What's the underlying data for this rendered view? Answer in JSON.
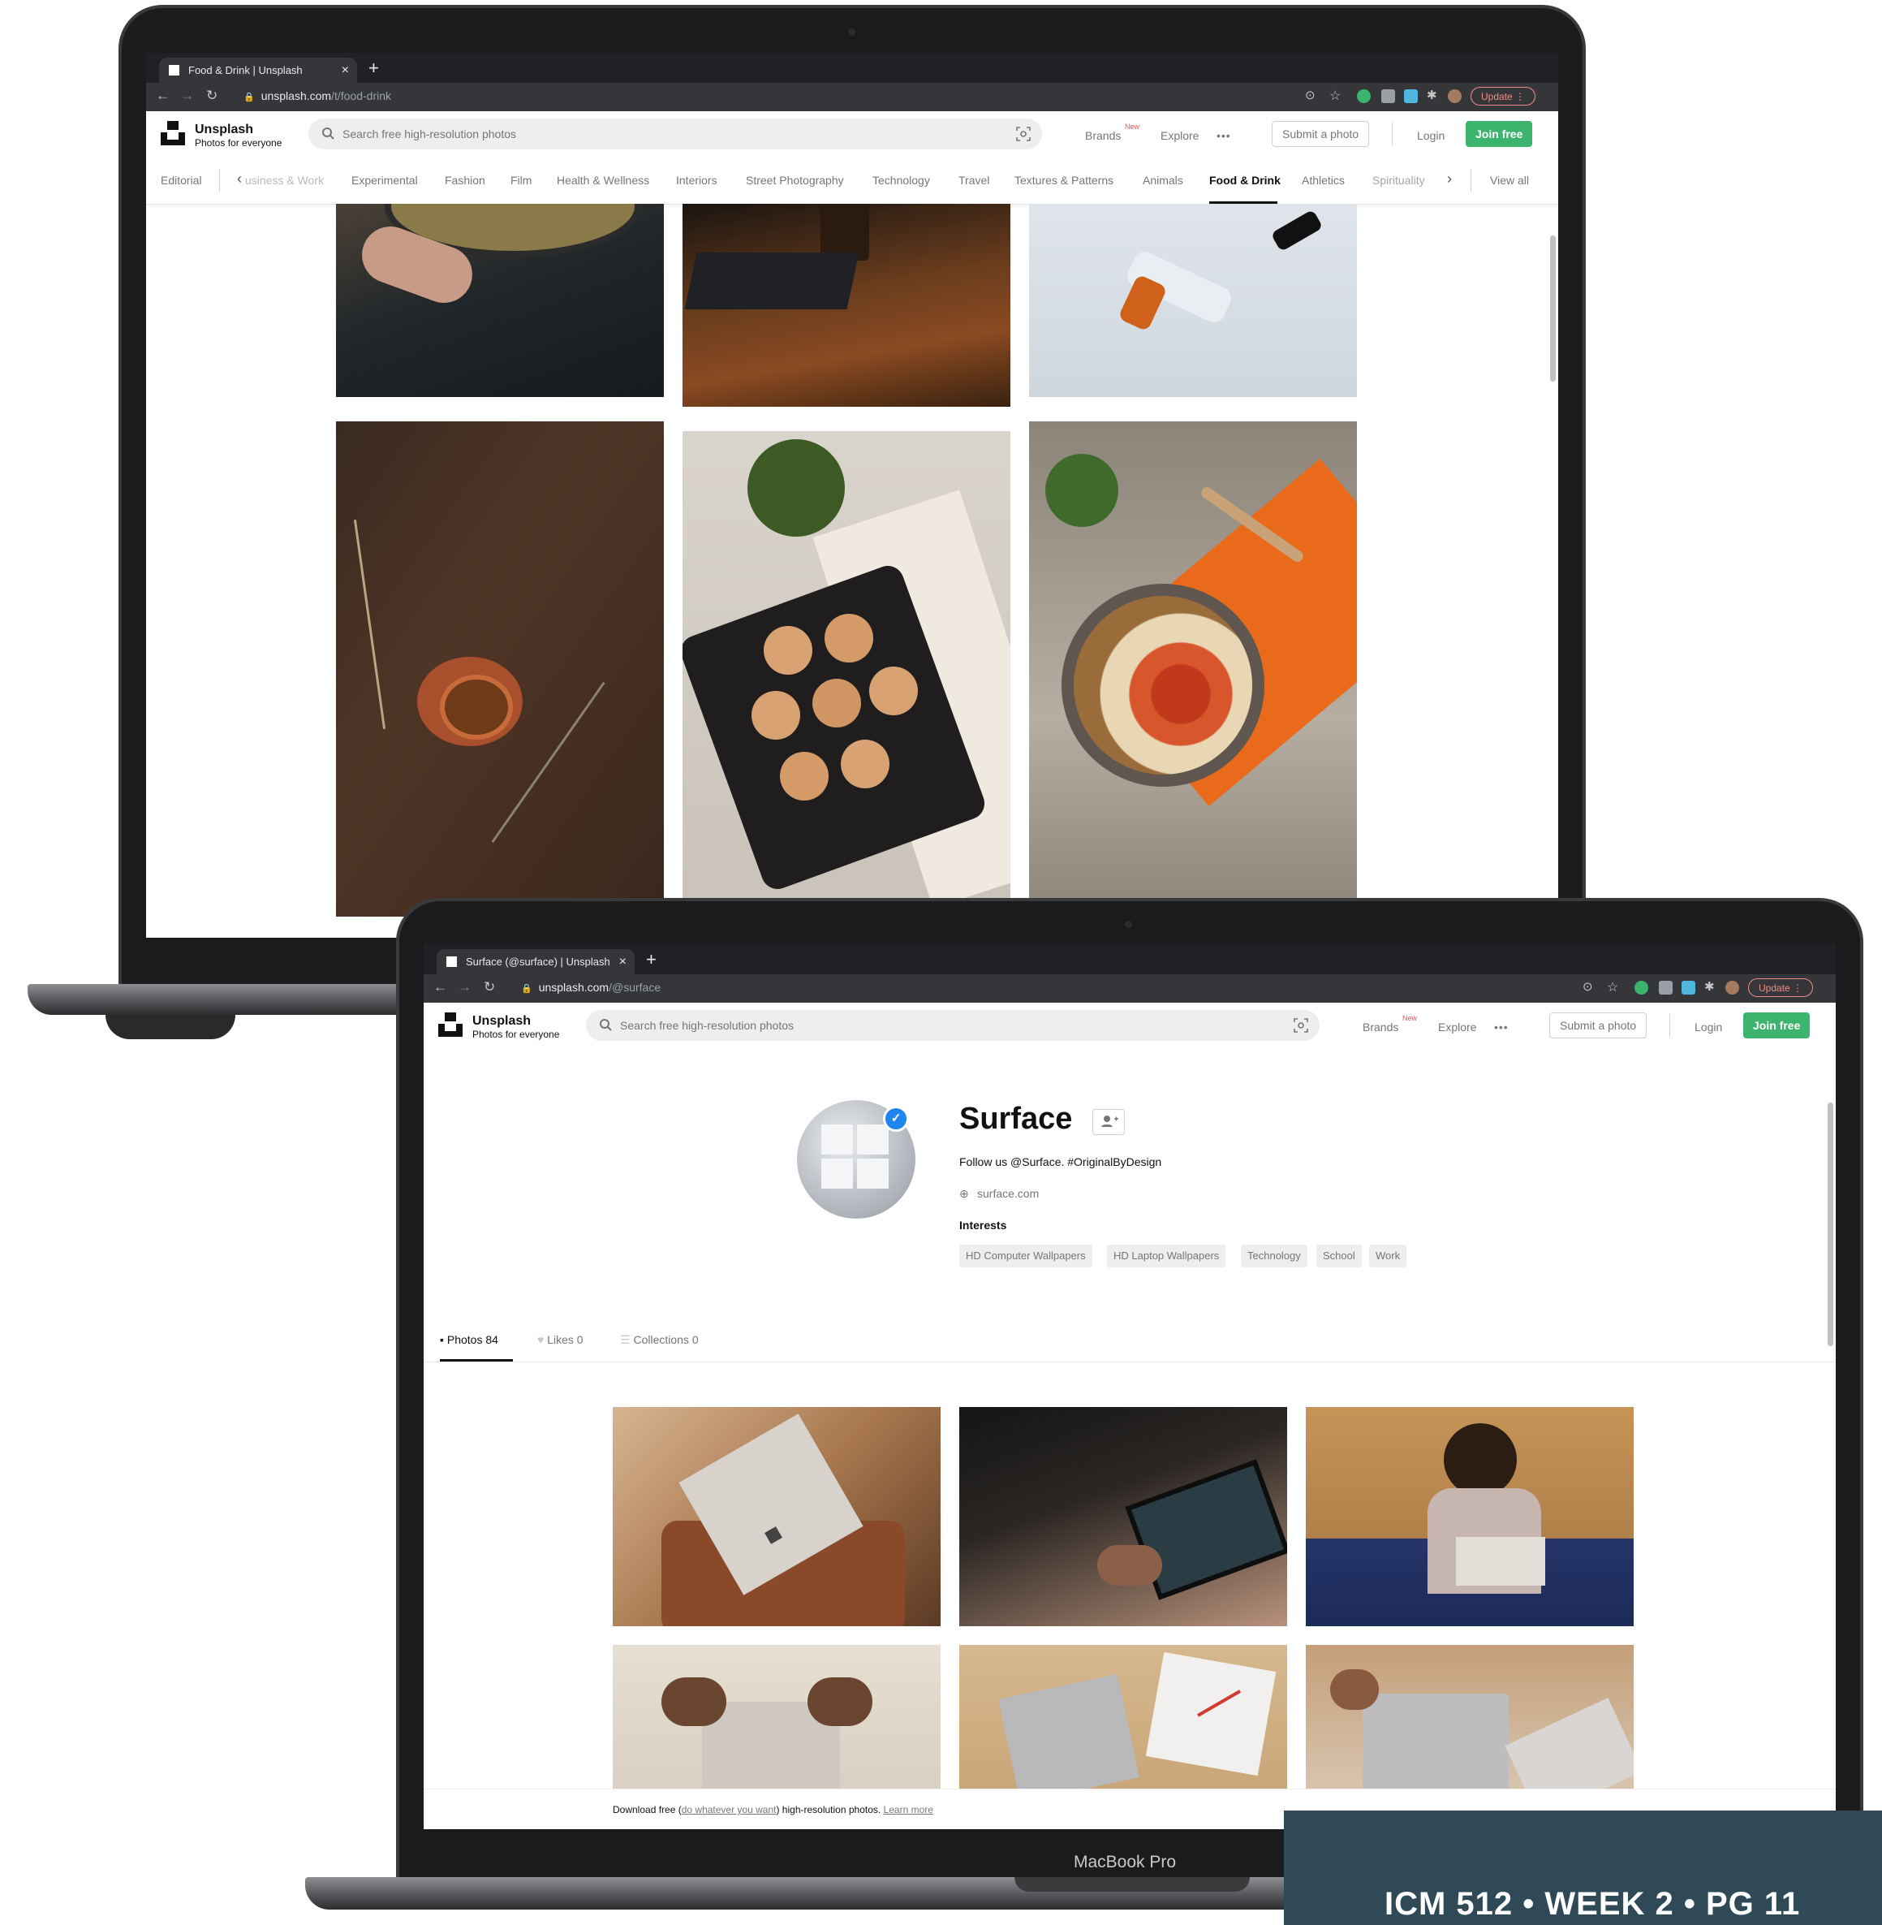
{
  "laptop1": {
    "tab_title": "Food & Drink | Unsplash",
    "url_host": "unsplash.com",
    "url_path": "/t/food-drink",
    "update_label": "Update",
    "brand": "Unsplash",
    "tagline": "Photos for everyone",
    "search_placeholder": "Search free high-resolution photos",
    "nav": {
      "brands": "Brands",
      "brands_badge": "New",
      "explore": "Explore",
      "more": "•••",
      "submit": "Submit a photo",
      "login": "Login",
      "join": "Join free"
    },
    "topics": [
      "Editorial",
      "usiness & Work",
      "Experimental",
      "Fashion",
      "Film",
      "Health & Wellness",
      "Interiors",
      "Street Photography",
      "Technology",
      "Travel",
      "Textures & Patterns",
      "Animals",
      "Food & Drink",
      "Athletics",
      "Spirituality"
    ],
    "active_topic": "Food & Drink",
    "view_all": "View all",
    "photos": [
      "hands-bowl",
      "wood-table-bottle",
      "oil-dropper",
      "tea-cup-dried-flowers",
      "scones-tray-newspaper",
      "salad-bowl-orange-cloth"
    ]
  },
  "laptop2": {
    "tab_title": "Surface (@surface) | Unsplash",
    "url_host": "unsplash.com",
    "url_path": "/@surface",
    "update_label": "Update",
    "brand": "Unsplash",
    "tagline": "Photos for everyone",
    "search_placeholder": "Search free high-resolution photos",
    "nav": {
      "brands": "Brands",
      "brands_badge": "New",
      "explore": "Explore",
      "more": "•••",
      "submit": "Submit a photo",
      "login": "Login",
      "join": "Join free"
    },
    "profile": {
      "name": "Surface",
      "bio": "Follow us @Surface. #OriginalByDesign",
      "website": "surface.com",
      "interests_label": "Interests",
      "interests": [
        "HD Computer Wallpapers",
        "HD Laptop Wallpapers",
        "Technology",
        "School",
        "Work"
      ]
    },
    "tabs": [
      {
        "label": "Photos 84",
        "icon": "image-icon"
      },
      {
        "label": "Likes 0",
        "icon": "heart-icon"
      },
      {
        "label": "Collections 0",
        "icon": "collections-icon"
      }
    ],
    "photos": [
      "laptop-into-bag",
      "tablet-game",
      "woman-laptop-couch",
      "hands-laptop-top",
      "laptop-notebook-desk",
      "typing-laptop"
    ],
    "footer": {
      "prefix": "Download free (",
      "link": "do whatever you want",
      "middle": ") high-resolution photos. ",
      "learn": "Learn more"
    }
  },
  "device_label": "MacBook Pro",
  "page_label": "ICM 512 • WEEK 2 • PG 11",
  "colors": {
    "accent_green": "#3cb46e",
    "band": "#2f4a56",
    "chrome_dark": "#202124",
    "verified_blue": "#1f86ef"
  }
}
